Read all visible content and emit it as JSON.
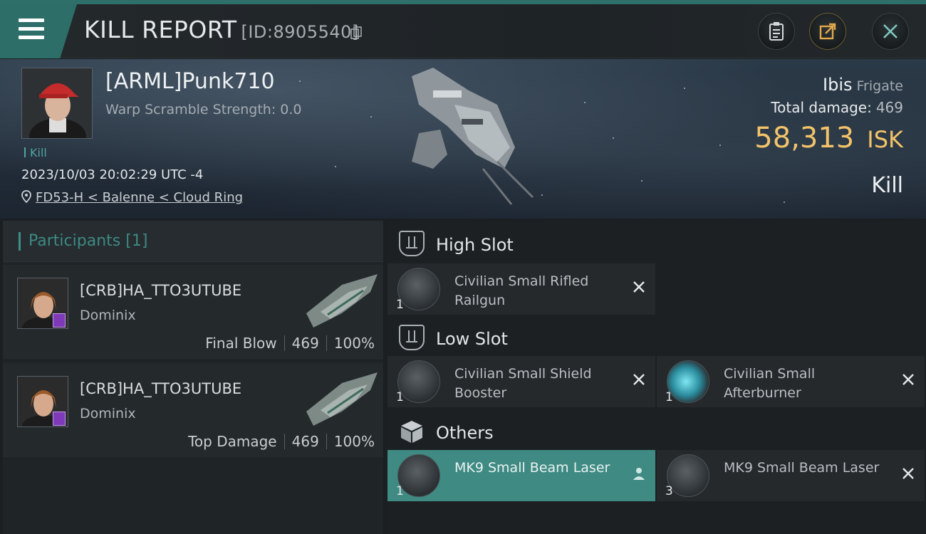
{
  "header": {
    "title": "KILL REPORT",
    "report_id": "[ID:8905540]",
    "menu_icon": "hamburger-menu-icon",
    "buttons": [
      "clipboard-icon",
      "share-icon",
      "close-icon"
    ]
  },
  "victim": {
    "name": "[ARML]Punk710",
    "warp_scramble": "Warp Scramble Strength: 0.0",
    "tag": "Kill",
    "datetime": "2023/10/03 20:02:29 UTC -4",
    "location": "FD53-H < Balenne < Cloud Ring",
    "ship_name": "Ibis",
    "ship_class": "Frigate",
    "total_damage_label": "Total damage:",
    "total_damage": "469",
    "isk_value": "58,313",
    "isk_unit": "ISK",
    "result": "Kill"
  },
  "participants": {
    "title": "Participants",
    "count": "[1]",
    "rows": [
      {
        "name": "[CRB]HA_TTO3UTUBE",
        "ship": "Dominix",
        "role": "Final Blow",
        "damage": "469",
        "percent": "100%"
      },
      {
        "name": "[CRB]HA_TTO3UTUBE",
        "ship": "Dominix",
        "role": "Top Damage",
        "damage": "469",
        "percent": "100%"
      }
    ]
  },
  "slots": {
    "high": {
      "label": "High Slot",
      "items": [
        {
          "qty": "1",
          "name": "Civilian Small Rifled Railgun"
        }
      ]
    },
    "low": {
      "label": "Low Slot",
      "items": [
        {
          "qty": "1",
          "name": "Civilian Small Shield Booster"
        },
        {
          "qty": "1",
          "name": "Civilian Small Afterburner"
        }
      ]
    },
    "others": {
      "label": "Others",
      "items": [
        {
          "qty": "1",
          "name": "MK9 Small Beam Laser"
        },
        {
          "qty": "3",
          "name": "MK9 Small Beam Laser"
        }
      ]
    }
  },
  "colors": {
    "accent": "#3f8a83",
    "isk": "#f3c36a",
    "background": "#1b1f22"
  }
}
